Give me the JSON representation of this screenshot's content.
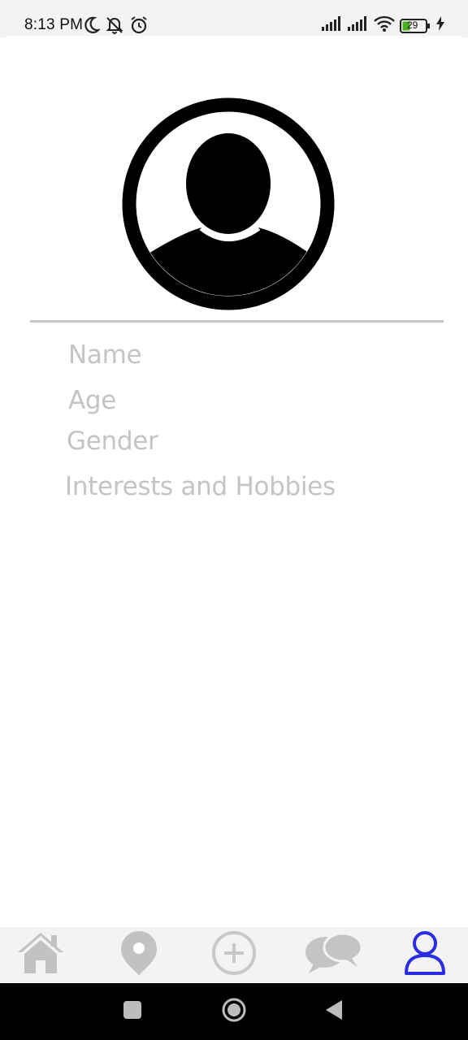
{
  "status_bar": {
    "time": "8:13 PM",
    "left_icons": [
      "moon-icon",
      "bell-off-icon",
      "alarm-icon"
    ],
    "right_icons": [
      "signal-icon",
      "signal-icon",
      "wifi-icon",
      "battery-icon",
      "charging-icon"
    ],
    "battery_level": "29",
    "battery_color": "#4caf22"
  },
  "profile": {
    "avatar_icon": "user-avatar-icon",
    "fields": {
      "name": "Name",
      "age": "Age",
      "gender": "Gender",
      "interests": "Interests and Hobbies"
    },
    "field_color": "#c4c4c4"
  },
  "bottom_nav": {
    "items": [
      {
        "icon": "home-icon",
        "active": false
      },
      {
        "icon": "location-pin-icon",
        "active": false
      },
      {
        "icon": "add-circle-icon",
        "active": false
      },
      {
        "icon": "chat-bubbles-icon",
        "active": false
      },
      {
        "icon": "profile-icon",
        "active": true
      }
    ],
    "inactive_color": "#c2c2c2",
    "active_color": "#2a2ee0"
  },
  "system_nav": {
    "buttons": [
      "recents-button",
      "home-button",
      "back-button"
    ]
  }
}
